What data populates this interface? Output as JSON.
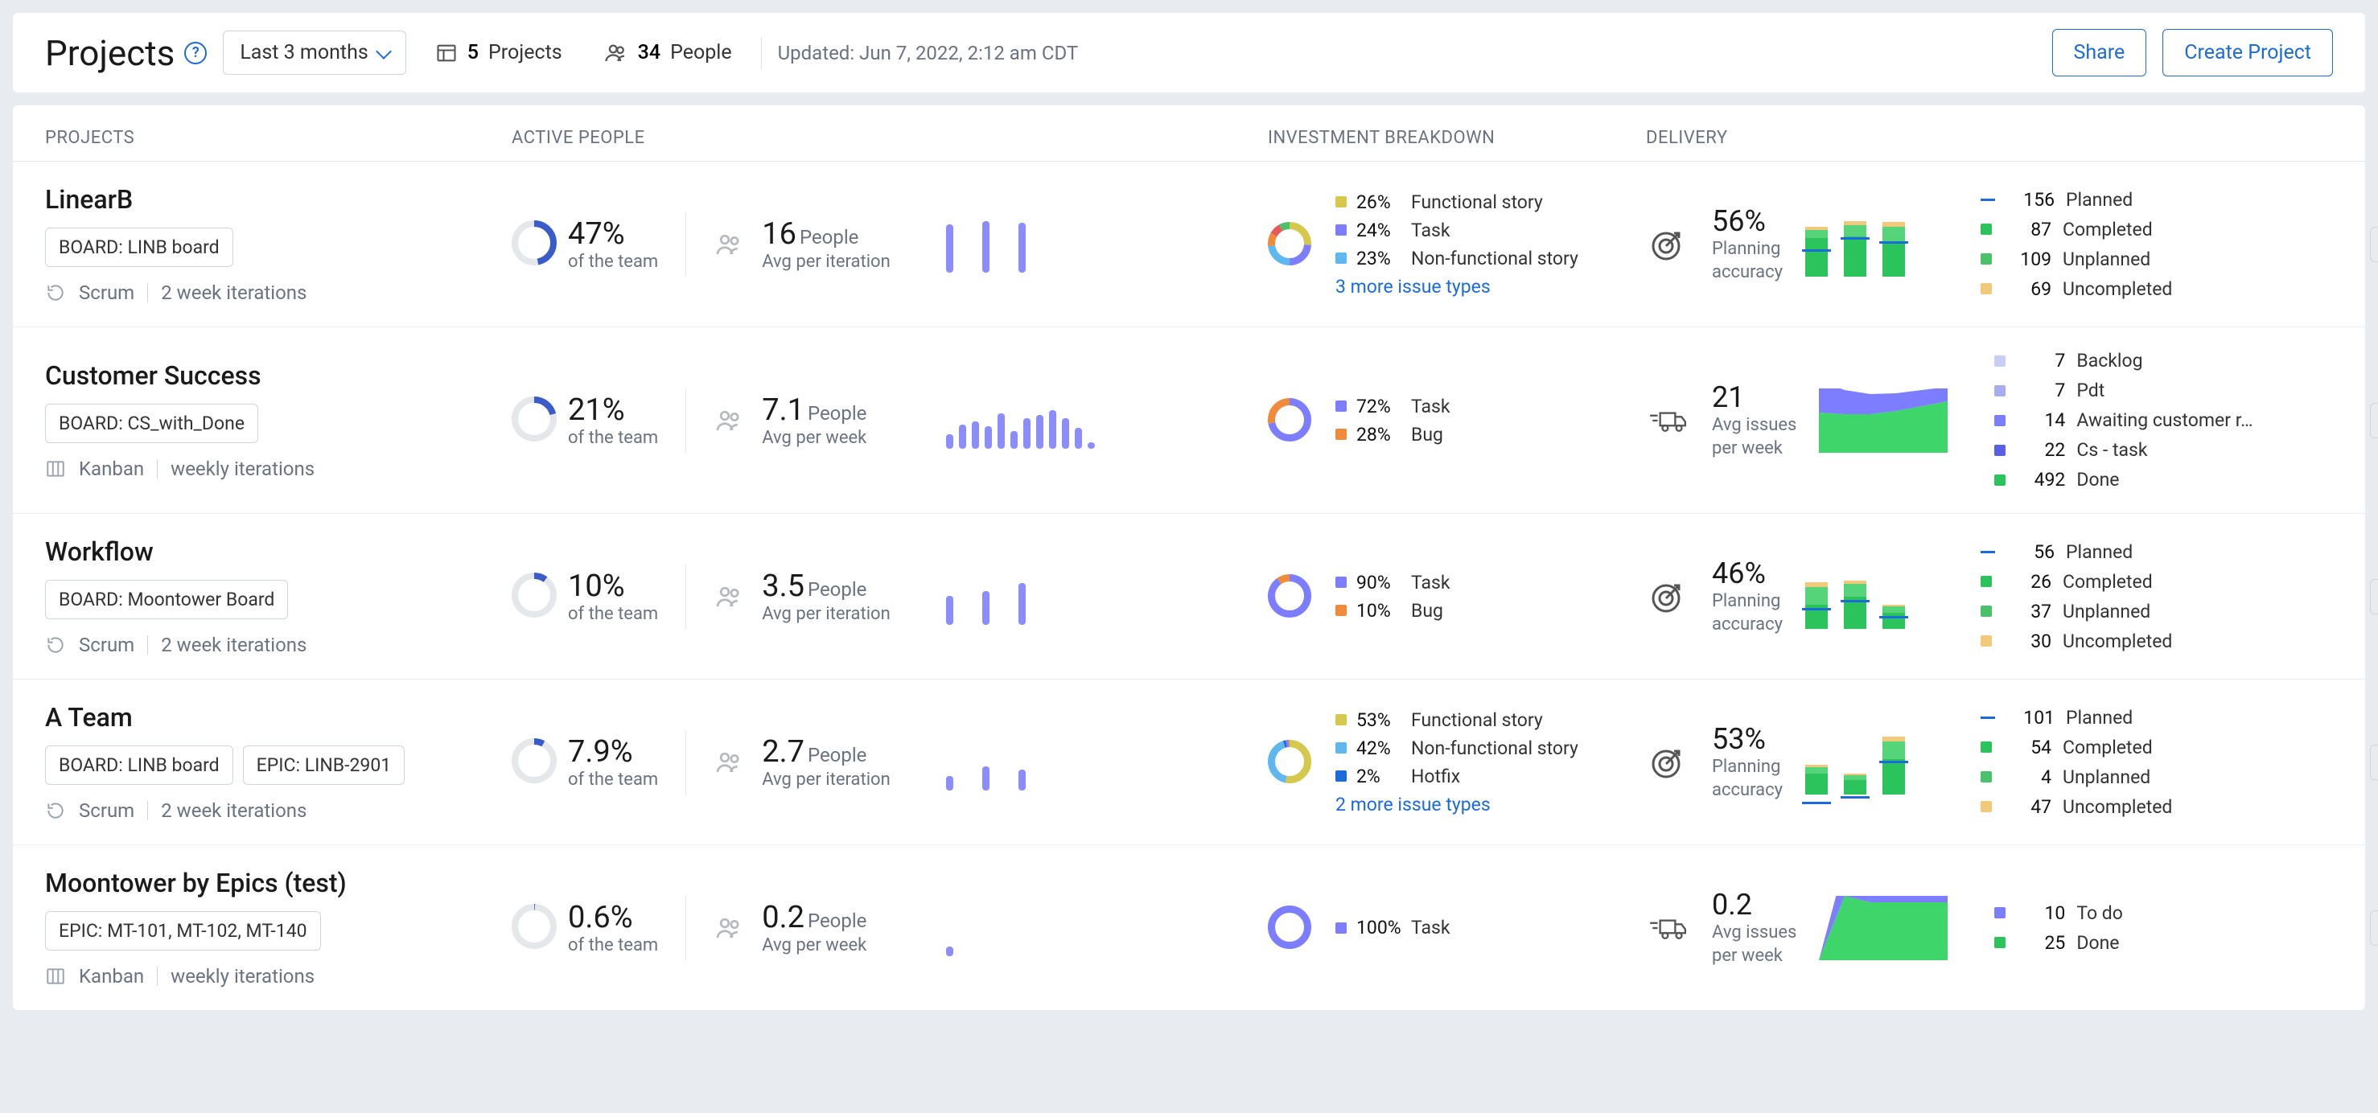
{
  "header": {
    "title": "Projects",
    "filter_label": "Last 3 months",
    "projects_count": "5",
    "projects_label": "Projects",
    "people_count": "34",
    "people_label": "People",
    "updated_label": "Updated: Jun 7, 2022, 2:12 am CDT",
    "share_label": "Share",
    "create_label": "Create Project"
  },
  "columns": {
    "projects": "PROJECTS",
    "active_people": "ACTIVE PEOPLE",
    "investment": "INVESTMENT BREAKDOWN",
    "delivery": "DELIVERY"
  },
  "labels": {
    "of_team": "of the team",
    "people_unit": "People",
    "planning_accuracy": "Planning accuracy",
    "avg_issues_per_week": "Avg issues per week",
    "more_issue_types_3": "3 more issue types",
    "more_issue_types_2": "2 more issue types"
  },
  "rows": [
    {
      "name": "LinearB",
      "tags": [
        "BOARD: LINB board"
      ],
      "method": "Scrum",
      "cadence": "2 week iterations",
      "method_icon": "scrum",
      "team_pct": "47%",
      "people_num": "16",
      "people_sub": "Avg per iteration",
      "spark": [
        60,
        64,
        62
      ],
      "spark_gap": 36,
      "investment": [
        {
          "pct": "26%",
          "label": "Functional story",
          "color": "#d5c84d"
        },
        {
          "pct": "24%",
          "label": "Task",
          "color": "#7c7eff"
        },
        {
          "pct": "23%",
          "label": "Non-functional story",
          "color": "#5fb7f0"
        }
      ],
      "invest_more": "3",
      "donut_segments": [
        [
          "#d5c84d",
          26
        ],
        [
          "#7c7eff",
          24
        ],
        [
          "#5fb7f0",
          23
        ],
        [
          "#f08b3c",
          10
        ],
        [
          "#e85a5a",
          9
        ],
        [
          "#4ac26b",
          8
        ]
      ],
      "delivery_type": "accuracy",
      "delivery_value": "56%",
      "stacks": [
        {
          "planned": 52,
          "completed": 48,
          "unplanned": 10,
          "uncompleted": 4
        },
        {
          "planned": 60,
          "completed": 50,
          "unplanned": 14,
          "uncompleted": 5
        },
        {
          "planned": 56,
          "completed": 44,
          "unplanned": 18,
          "uncompleted": 6
        }
      ],
      "statuses": [
        {
          "count": "156",
          "label": "Planned",
          "color": "#1c6bdb",
          "dash": true
        },
        {
          "count": "87",
          "label": "Completed",
          "color": "#2bc35b"
        },
        {
          "count": "109",
          "label": "Unplanned",
          "color": "#4ac26b"
        },
        {
          "count": "69",
          "label": "Uncompleted",
          "color": "#f0c97a"
        }
      ]
    },
    {
      "name": "Customer Success",
      "tags": [
        "BOARD: CS_with_Done"
      ],
      "method": "Kanban",
      "cadence": "weekly iterations",
      "method_icon": "kanban",
      "team_pct": "21%",
      "people_num": "7.1",
      "people_sub": "Avg per week",
      "spark": [
        18,
        30,
        34,
        28,
        44,
        22,
        38,
        42,
        48,
        38,
        26,
        8
      ],
      "spark_gap": 7,
      "investment": [
        {
          "pct": "72%",
          "label": "Task",
          "color": "#7c7eff"
        },
        {
          "pct": "28%",
          "label": "Bug",
          "color": "#f08b3c"
        }
      ],
      "donut_segments": [
        [
          "#7c7eff",
          72
        ],
        [
          "#f08b3c",
          28
        ]
      ],
      "delivery_type": "throughput",
      "delivery_value": "21",
      "area_top": "40,30,25,22,20,18",
      "area_bottom": "50,48,48,52,58,64",
      "statuses": [
        {
          "count": "7",
          "label": "Backlog",
          "color": "#c9cdf5"
        },
        {
          "count": "7",
          "label": "Pdt",
          "color": "#a7adf0"
        },
        {
          "count": "14",
          "label": "Awaiting customer r…",
          "color": "#7c7eff"
        },
        {
          "count": "22",
          "label": "Cs - task",
          "color": "#5a5de8"
        },
        {
          "count": "492",
          "label": "Done",
          "color": "#2bc35b"
        }
      ]
    },
    {
      "name": "Workflow",
      "tags": [
        "BOARD: Moontower Board"
      ],
      "method": "Scrum",
      "cadence": "2 week iterations",
      "method_icon": "scrum",
      "team_pct": "10%",
      "people_num": "3.5",
      "people_sub": "Avg per iteration",
      "spark": [
        36,
        42,
        52
      ],
      "spark_gap": 36,
      "investment": [
        {
          "pct": "90%",
          "label": "Task",
          "color": "#7c7eff"
        },
        {
          "pct": "10%",
          "label": "Bug",
          "color": "#f08b3c"
        }
      ],
      "donut_segments": [
        [
          "#7c7eff",
          90
        ],
        [
          "#f08b3c",
          10
        ]
      ],
      "delivery_type": "accuracy",
      "delivery_value": "46%",
      "stacks": [
        {
          "planned": 48,
          "completed": 30,
          "unplanned": 22,
          "uncompleted": 6
        },
        {
          "planned": 56,
          "completed": 40,
          "unplanned": 16,
          "uncompleted": 4
        },
        {
          "planned": 66,
          "completed": 20,
          "unplanned": 8,
          "uncompleted": 2
        }
      ],
      "statuses": [
        {
          "count": "56",
          "label": "Planned",
          "color": "#1c6bdb",
          "dash": true
        },
        {
          "count": "26",
          "label": "Completed",
          "color": "#2bc35b"
        },
        {
          "count": "37",
          "label": "Unplanned",
          "color": "#4ac26b"
        },
        {
          "count": "30",
          "label": "Uncompleted",
          "color": "#f0c97a"
        }
      ]
    },
    {
      "name": "A Team",
      "tags": [
        "BOARD: LINB board",
        "EPIC: LINB-2901"
      ],
      "method": "Scrum",
      "cadence": "2 week iterations",
      "method_icon": "scrum",
      "team_pct": "7.9%",
      "people_num": "2.7",
      "people_sub": "Avg per iteration",
      "spark": [
        18,
        30,
        26
      ],
      "spark_gap": 36,
      "investment": [
        {
          "pct": "53%",
          "label": "Functional story",
          "color": "#d5c84d"
        },
        {
          "pct": "42%",
          "label": "Non-functional story",
          "color": "#5fb7f0"
        },
        {
          "pct": "2%",
          "label": "Hotfix",
          "color": "#1c6bdb"
        }
      ],
      "invest_more": "2",
      "donut_segments": [
        [
          "#d5c84d",
          53
        ],
        [
          "#5fb7f0",
          42
        ],
        [
          "#1c6bdb",
          2
        ],
        [
          "#7c7eff",
          2
        ],
        [
          "#f08b3c",
          1
        ]
      ],
      "delivery_type": "accuracy",
      "delivery_value": "53%",
      "stacks": [
        {
          "planned": 34,
          "completed": 26,
          "unplanned": 8,
          "uncompleted": 3
        },
        {
          "planned": 52,
          "completed": 18,
          "unplanned": 6,
          "uncompleted": 2
        },
        {
          "planned": 50,
          "completed": 44,
          "unplanned": 22,
          "uncompleted": 6
        }
      ],
      "statuses": [
        {
          "count": "101",
          "label": "Planned",
          "color": "#1c6bdb",
          "dash": true
        },
        {
          "count": "54",
          "label": "Completed",
          "color": "#2bc35b"
        },
        {
          "count": "4",
          "label": "Unplanned",
          "color": "#4ac26b"
        },
        {
          "count": "47",
          "label": "Uncompleted",
          "color": "#f0c97a"
        }
      ]
    },
    {
      "name": "Moontower by Epics (test)",
      "tags": [
        "EPIC: MT-101, MT-102, MT-140"
      ],
      "method": "Kanban",
      "cadence": "weekly iterations",
      "method_icon": "kanban",
      "team_pct": "0.6%",
      "people_num": "0.2",
      "people_sub": "Avg per week",
      "spark": [
        12
      ],
      "spark_gap": 36,
      "investment": [
        {
          "pct": "100%",
          "label": "Task",
          "color": "#7c7eff"
        }
      ],
      "donut_segments": [
        [
          "#7c7eff",
          100
        ]
      ],
      "delivery_type": "throughput",
      "delivery_value": "0.2",
      "area_top": "0,40,36,36,36,36",
      "area_bottom": "0,80,72,72,72,72",
      "statuses": [
        {
          "count": "10",
          "label": "To do",
          "color": "#7c7eff"
        },
        {
          "count": "25",
          "label": "Done",
          "color": "#2bc35b"
        }
      ]
    }
  ],
  "chart_data": [
    {
      "project": "LinearB",
      "type": "bar",
      "metric": "Active people per iteration",
      "values": [
        16,
        17,
        16
      ],
      "avg": 16
    },
    {
      "project": "LinearB",
      "type": "pie",
      "metric": "Investment breakdown %",
      "slices": {
        "Functional story": 26,
        "Task": 24,
        "Non-functional story": 23,
        "Other (3 types)": 27
      }
    },
    {
      "project": "LinearB",
      "type": "bar",
      "metric": "Delivery categories",
      "categories": [
        "Planned",
        "Completed",
        "Unplanned",
        "Uncompleted"
      ],
      "values": [
        156,
        87,
        109,
        69
      ],
      "planning_accuracy_pct": 56
    },
    {
      "project": "Customer Success",
      "type": "bar",
      "metric": "Active people per week",
      "values": [
        3,
        5,
        5.5,
        4.5,
        7,
        3.5,
        6,
        6.8,
        7.8,
        6.2,
        4.2,
        1.3
      ],
      "avg": 7.1
    },
    {
      "project": "Customer Success",
      "type": "pie",
      "metric": "Investment breakdown %",
      "slices": {
        "Task": 72,
        "Bug": 28
      }
    },
    {
      "project": "Customer Success",
      "type": "area",
      "metric": "Issue status over time",
      "series": [
        {
          "name": "Backlog",
          "values": [
            7
          ]
        },
        {
          "name": "Pdt",
          "values": [
            7
          ]
        },
        {
          "name": "Awaiting customer response",
          "values": [
            14
          ]
        },
        {
          "name": "Cs - task",
          "values": [
            22
          ]
        },
        {
          "name": "Done",
          "values": [
            492
          ]
        }
      ],
      "avg_issues_per_week": 21
    },
    {
      "project": "Workflow",
      "type": "bar",
      "metric": "Active people per iteration",
      "values": [
        3,
        3.5,
        4
      ],
      "avg": 3.5
    },
    {
      "project": "Workflow",
      "type": "pie",
      "metric": "Investment breakdown %",
      "slices": {
        "Task": 90,
        "Bug": 10
      }
    },
    {
      "project": "Workflow",
      "type": "bar",
      "metric": "Delivery categories",
      "categories": [
        "Planned",
        "Completed",
        "Unplanned",
        "Uncompleted"
      ],
      "values": [
        56,
        26,
        37,
        30
      ],
      "planning_accuracy_pct": 46
    },
    {
      "project": "A Team",
      "type": "bar",
      "metric": "Active people per iteration",
      "values": [
        1.8,
        3,
        2.6
      ],
      "avg": 2.7
    },
    {
      "project": "A Team",
      "type": "pie",
      "metric": "Investment breakdown %",
      "slices": {
        "Functional story": 53,
        "Non-functional story": 42,
        "Hotfix": 2,
        "Other (2 types)": 3
      }
    },
    {
      "project": "A Team",
      "type": "bar",
      "metric": "Delivery categories",
      "categories": [
        "Planned",
        "Completed",
        "Unplanned",
        "Uncompleted"
      ],
      "values": [
        101,
        54,
        4,
        47
      ],
      "planning_accuracy_pct": 53
    },
    {
      "project": "Moontower by Epics (test)",
      "type": "bar",
      "metric": "Active people per week",
      "values": [
        0.2
      ],
      "avg": 0.2
    },
    {
      "project": "Moontower by Epics (test)",
      "type": "pie",
      "metric": "Investment breakdown %",
      "slices": {
        "Task": 100
      }
    },
    {
      "project": "Moontower by Epics (test)",
      "type": "area",
      "metric": "Issue status over time",
      "series": [
        {
          "name": "To do",
          "values": [
            10
          ]
        },
        {
          "name": "Done",
          "values": [
            25
          ]
        }
      ],
      "avg_issues_per_week": 0.2
    }
  ]
}
